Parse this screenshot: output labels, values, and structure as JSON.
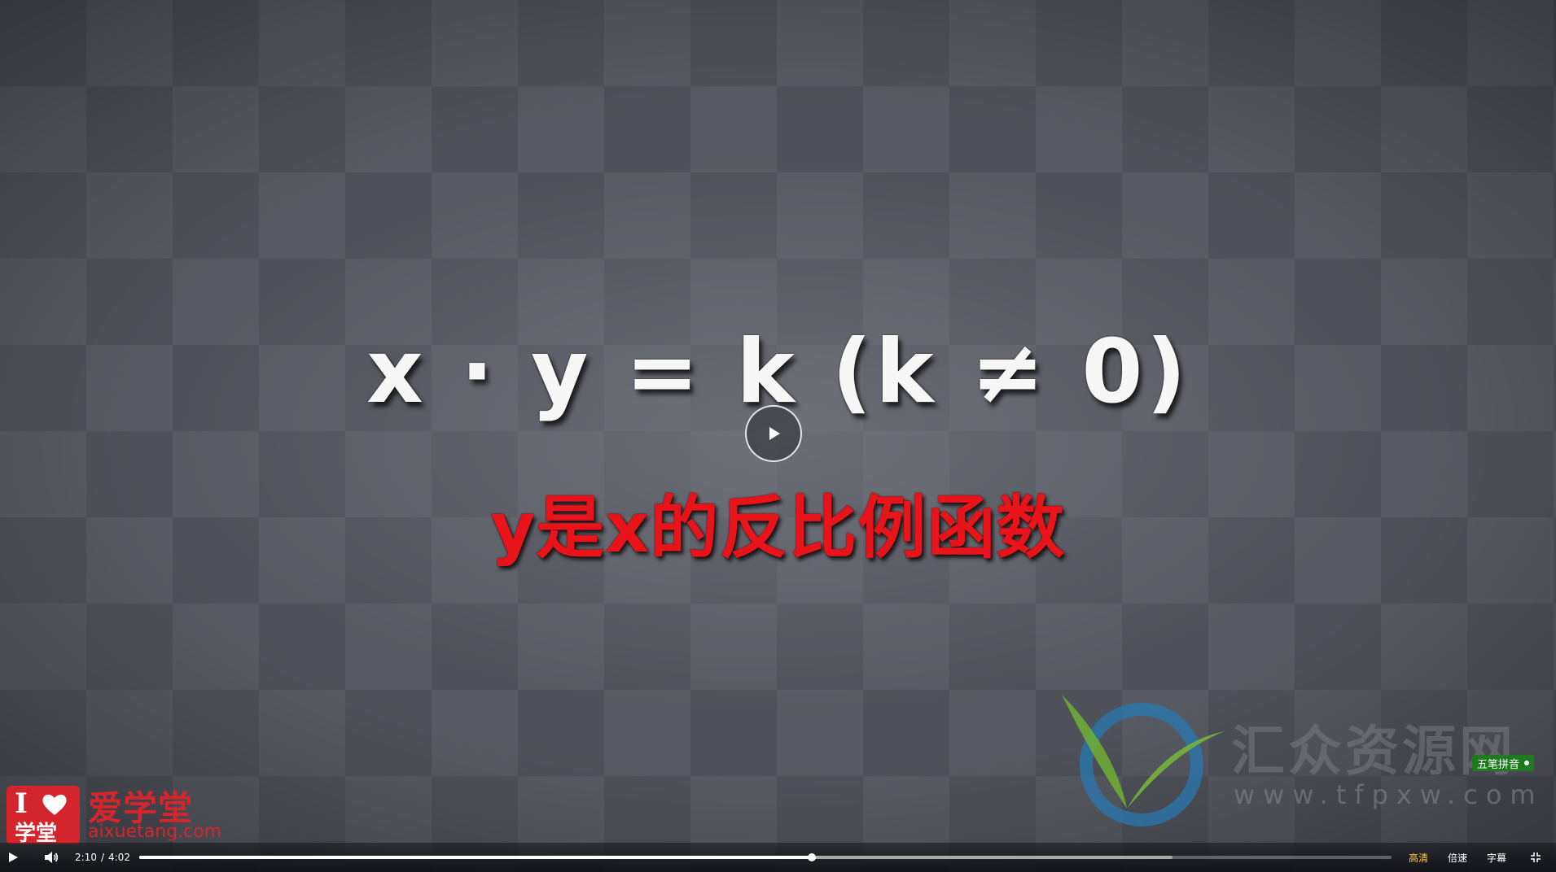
{
  "video": {
    "formula": "x · y = k (k ≠ 0)",
    "subtitle": "y是x的反比例函数"
  },
  "watermark": {
    "site_name": "汇众资源网",
    "site_url": "www.tfpxw.com"
  },
  "corner_logo": {
    "badge_text": "I",
    "badge_text_2": "学堂",
    "name": "爱学堂",
    "url": "aixuetang.com"
  },
  "ime_indicator": {
    "label": "五笔拼音"
  },
  "player": {
    "current_time": "2:10",
    "separator": "/",
    "duration": "4:02",
    "progress_fraction": 0.537,
    "buffered_fraction": 0.825,
    "quality_label": "高清",
    "speed_label": "倍速",
    "subtitle_label": "字幕",
    "icons": [
      "play-icon",
      "volume-icon",
      "big-play-icon",
      "exit-fullscreen-icon",
      "heart-icon",
      "checkmark-logo-icon"
    ],
    "colors": {
      "quality": "#f5c842",
      "accent_red": "#d4242c",
      "subtitle_red": "#e8141a"
    }
  }
}
